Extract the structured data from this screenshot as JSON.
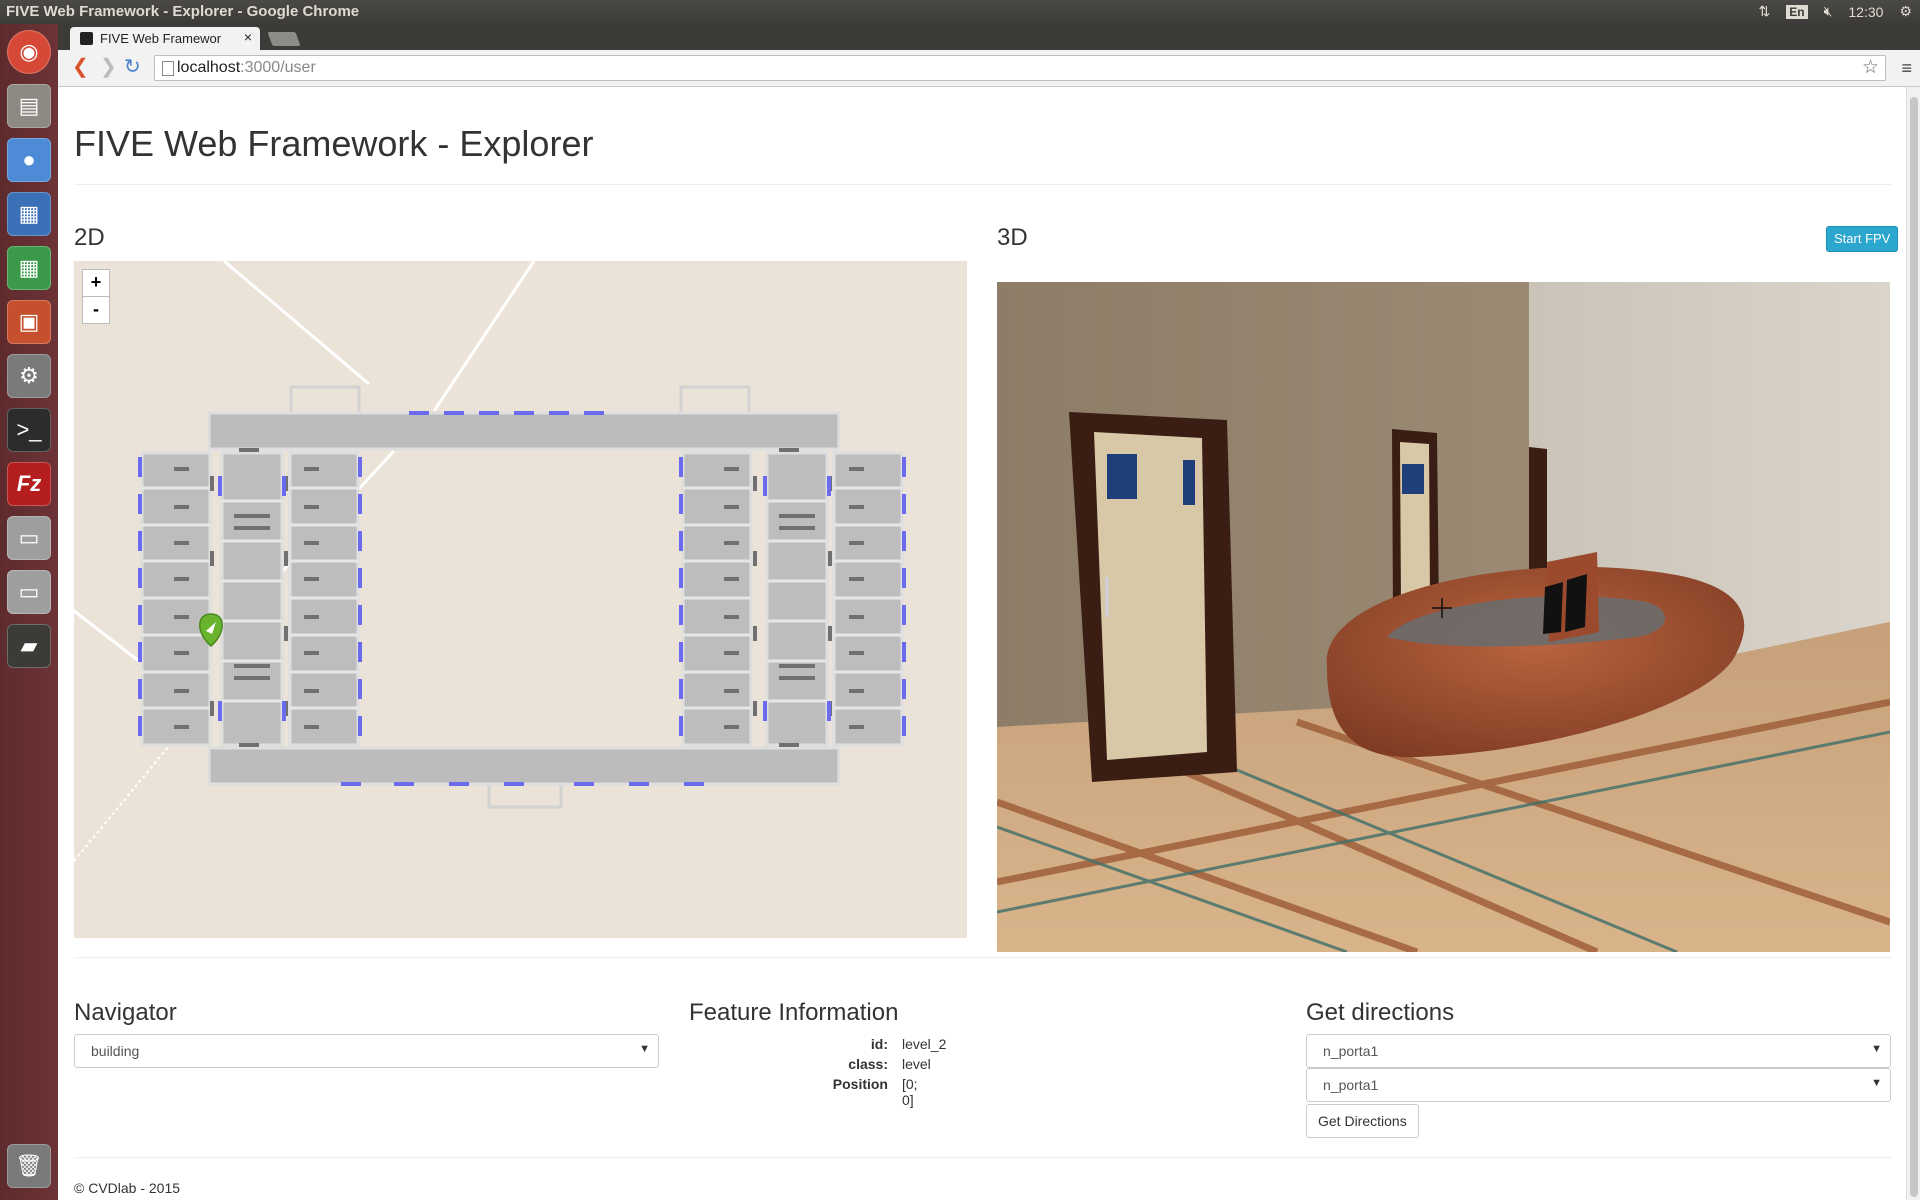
{
  "system": {
    "window_title": "FIVE Web Framework - Explorer - Google Chrome",
    "keyboard": "En",
    "clock": "12:30"
  },
  "browser": {
    "tab_title": "FIVE Web Framewor",
    "url_host": "localhost",
    "url_path": ":3000/user"
  },
  "app": {
    "title": "FIVE Web Framework - Explorer",
    "panel_2d": "2D",
    "panel_3d": "3D",
    "start_fpv": "Start FPV",
    "zoom_in": "+",
    "zoom_out": "-"
  },
  "navigator": {
    "heading": "Navigator",
    "selected": "building"
  },
  "feature_info": {
    "heading": "Feature Information",
    "rows": [
      {
        "key": "id:",
        "value": "level_2"
      },
      {
        "key": "class:",
        "value": "level"
      },
      {
        "key": "Position",
        "value": "[0; 0]"
      }
    ]
  },
  "directions": {
    "heading": "Get directions",
    "from": "n_porta1",
    "to": "n_porta1",
    "button": "Get Directions"
  },
  "footer": "© CVDlab - 2015",
  "colors": {
    "launcher": "#5e2b2d",
    "map_bg": "#ebe3d8",
    "door_blue": "#6b6bf0",
    "fpv_button": "#2aa6cf"
  }
}
